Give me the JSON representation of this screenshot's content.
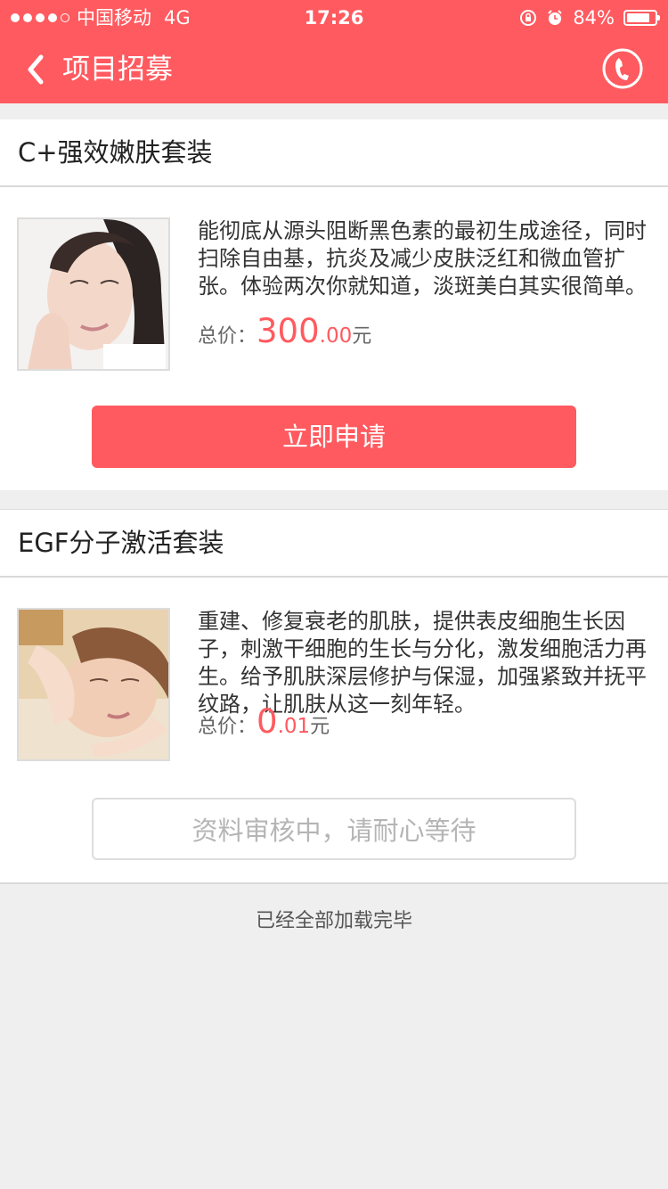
{
  "status_bar": {
    "carrier": "中国移动",
    "network": "4G",
    "time": "17:26",
    "battery": "84%",
    "battery_level": 0.84
  },
  "nav": {
    "title": "项目招募"
  },
  "products": [
    {
      "title": "C+强效嫩肤套装",
      "description": "能彻底从源头阻断黑色素的最初生成途径，同时扫除自由基，抗炎及减少皮肤泛红和微血管扩张。体验两次你就知道，淡斑美白其实很简单。",
      "price_label": "总价：",
      "price_int": "300",
      "price_dec": ".00",
      "price_unit": "元",
      "button_label": "立即申请"
    },
    {
      "title": "EGF分子激活套装",
      "description": "重建、修复衰老的肌肤，提供表皮细胞生长因子，刺激干细胞的生长与分化，激发细胞活力再生。给予肌肤深层修护与保湿，加强紧致并抚平纹路，让肌肤从这一刻年轻。",
      "price_label": "总价：",
      "price_int": "0",
      "price_dec": ".01",
      "price_unit": "元",
      "button_label": "资料审核中，请耐心等待"
    }
  ],
  "footer": {
    "text": "已经全部加载完毕"
  },
  "colors": {
    "accent": "#ff5a5f",
    "background": "#efefef"
  }
}
